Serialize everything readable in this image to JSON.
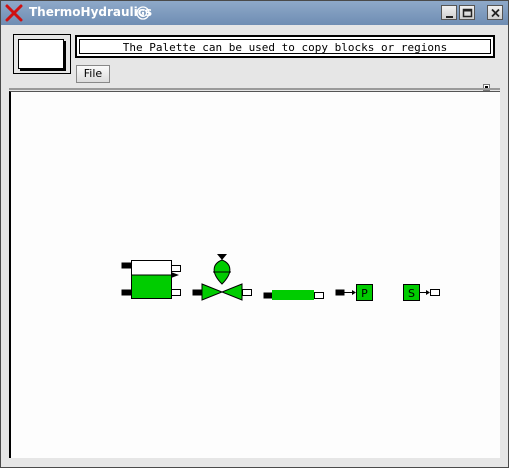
{
  "window": {
    "title": "ThermoHydraulics",
    "controls": [
      "minimize-icon",
      "maximize-icon",
      "close-icon"
    ]
  },
  "toolbar": {
    "message": "The Palette can be used to copy blocks or regions",
    "menu": {
      "file_label": "File"
    }
  },
  "palette": {
    "blocks": [
      {
        "kind": "tank",
        "icon": "tank-icon"
      },
      {
        "kind": "valve",
        "icon": "valve-icon"
      },
      {
        "kind": "pipe",
        "icon": "pipe-icon"
      },
      {
        "kind": "pressure-sensor",
        "icon": "pressure-sensor-icon",
        "label": "P"
      },
      {
        "kind": "source",
        "icon": "source-icon",
        "label": "S"
      }
    ],
    "colors": {
      "fill": "#00cc00",
      "port": "#000000",
      "canvas": "#fdfdfd"
    }
  }
}
